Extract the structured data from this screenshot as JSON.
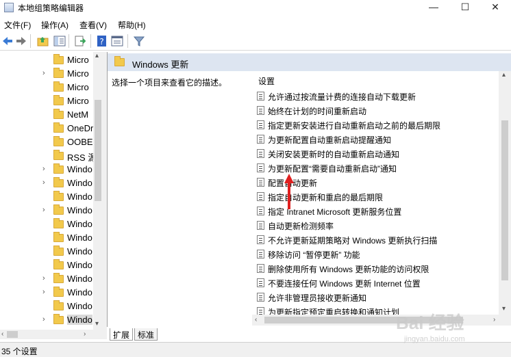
{
  "window": {
    "title": "本地组策略编辑器",
    "controls": {
      "minimize": "—",
      "maximize": "☐",
      "close": "✕"
    }
  },
  "menu": [
    "文件(F)",
    "操作(A)",
    "查看(V)",
    "帮助(H)"
  ],
  "toolbar": {
    "icons": [
      "back-arrow-icon",
      "forward-arrow-icon",
      "up-folder-icon",
      "show-hide-tree-icon",
      "export-list-icon",
      "help-icon",
      "properties-icon",
      "filter-icon"
    ]
  },
  "tree": {
    "items": [
      {
        "label": "Micro",
        "expandable": false
      },
      {
        "label": "Micro",
        "expandable": true
      },
      {
        "label": "Micro",
        "expandable": false
      },
      {
        "label": "Micro",
        "expandable": false
      },
      {
        "label": "NetM",
        "expandable": false
      },
      {
        "label": "OneDr",
        "expandable": false
      },
      {
        "label": "OOBE",
        "expandable": false
      },
      {
        "label": "RSS 源",
        "expandable": false
      },
      {
        "label": "Windo",
        "expandable": true
      },
      {
        "label": "Windo",
        "expandable": true
      },
      {
        "label": "Windo",
        "expandable": false
      },
      {
        "label": "Windo",
        "expandable": true
      },
      {
        "label": "Windo",
        "expandable": false
      },
      {
        "label": "Windo",
        "expandable": false
      },
      {
        "label": "Windo",
        "expandable": false
      },
      {
        "label": "Windo",
        "expandable": false
      },
      {
        "label": "Windo",
        "expandable": true
      },
      {
        "label": "Windo",
        "expandable": true
      },
      {
        "label": "Windo",
        "expandable": false
      },
      {
        "label": "Windo",
        "expandable": true,
        "selected": true
      }
    ]
  },
  "right": {
    "header_title": "Windows 更新",
    "description": "选择一个项目来查看它的描述。",
    "column_header": "设置",
    "settings": [
      "允许通过按流量计费的连接自动下载更新",
      "始终在计划的时间重新启动",
      "指定更新安装进行自动重新启动之前的最后期限",
      "为更新配置自动重新启动提醒通知",
      "关闭安装更新时的自动重新启动通知",
      "为更新配置“需要自动重新启动”通知",
      "配置自动更新",
      "指定自动更新和重启的最后期限",
      "指定 Intranet Microsoft 更新服务位置",
      "自动更新检测频率",
      "不允许更新延期策略对 Windows 更新执行扫描",
      "移除访问 “暂停更新” 功能",
      "删除使用所有 Windows 更新功能的访问权限",
      "不要连接任何 Windows 更新 Internet 位置",
      "允许非管理员接收更新通知",
      "为更新指定预定重启转换和通知计划"
    ]
  },
  "tabs": [
    "扩展",
    "标准"
  ],
  "status": "35 个设置",
  "watermark": {
    "main": "Bai 经验",
    "sub": "jingyan.baidu.com"
  },
  "colors": {
    "header_bg": "#dde5f1",
    "annotation_red": "#e02020",
    "folder": "#f2c94c"
  }
}
